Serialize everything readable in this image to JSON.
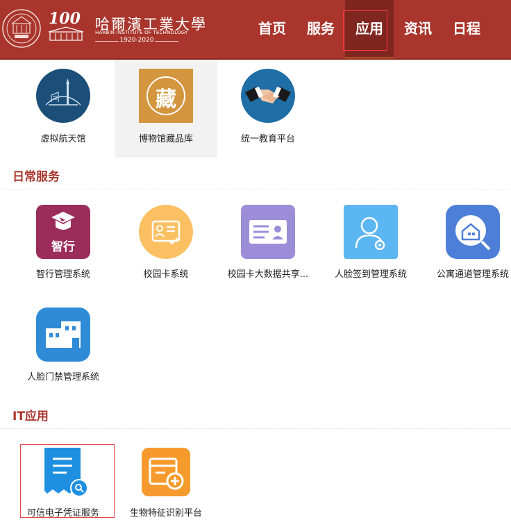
{
  "header": {
    "logo_cn": "哈爾濱工業大學",
    "logo_en": "HARBIN INSTITUTE OF TECHNOLOGY",
    "logo_years": "1920-2020",
    "badge_number": "100",
    "nav": [
      {
        "label": "首页"
      },
      {
        "label": "服务"
      },
      {
        "label": "应用"
      },
      {
        "label": "资讯"
      },
      {
        "label": "日程"
      }
    ]
  },
  "top_apps": [
    {
      "label": "虚拟航天馆",
      "icon": "space-museum-icon"
    },
    {
      "label": "博物馆藏品库",
      "icon": "museum-collection-icon",
      "glyph": "藏"
    },
    {
      "label": "统一教育平台",
      "icon": "handshake-icon"
    }
  ],
  "daily_services": {
    "title": "日常服务",
    "apps": [
      {
        "label": "智行管理系统",
        "icon": "zhixing-icon",
        "glyph": "智行"
      },
      {
        "label": "校园卡系统",
        "icon": "campus-card-icon"
      },
      {
        "label": "校园卡大数据共享...",
        "icon": "id-card-icon"
      },
      {
        "label": "人脸签到管理系统",
        "icon": "face-checkin-icon"
      },
      {
        "label": "公寓通道管理系统",
        "icon": "apartment-search-icon"
      },
      {
        "label": "人脸门禁管理系统",
        "icon": "building-icon"
      }
    ]
  },
  "it_apps": {
    "title": "IT应用",
    "apps": [
      {
        "label": "可信电子凭证服务",
        "icon": "certificate-icon"
      },
      {
        "label": "生物特征识别平台",
        "icon": "biometric-add-icon"
      }
    ]
  },
  "colors": {
    "brand": "#a9352c",
    "nav_active": "#7f2620",
    "accent": "#f0a020"
  }
}
